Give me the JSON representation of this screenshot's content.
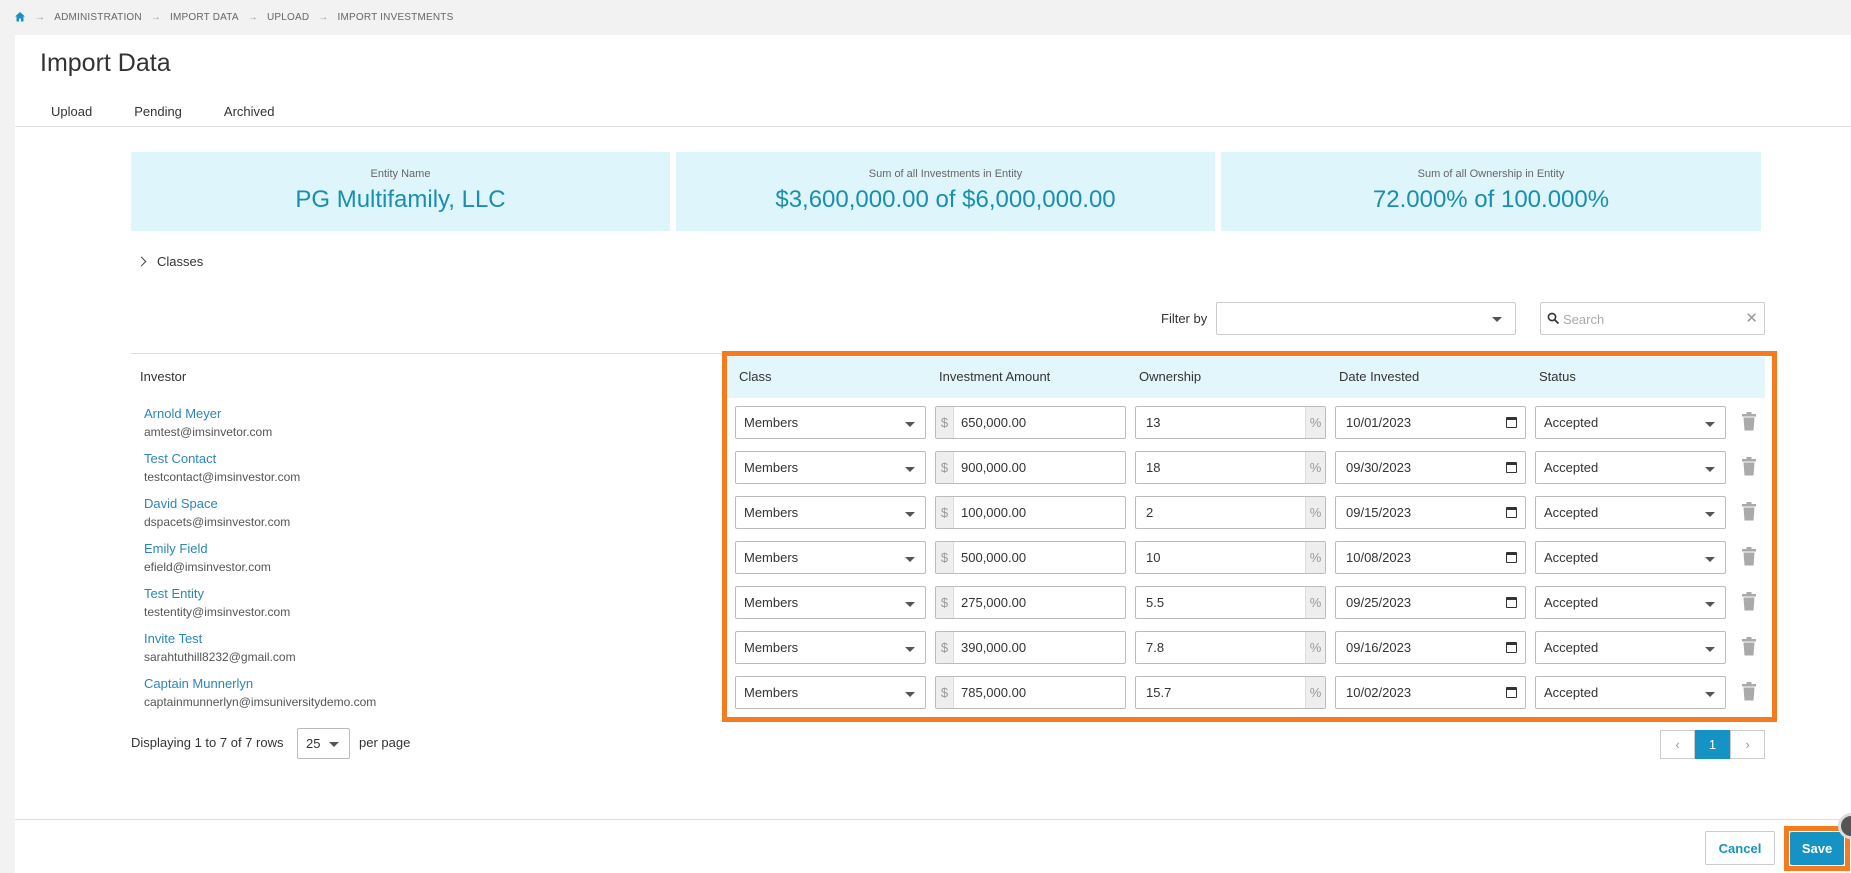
{
  "breadcrumb": [
    "ADMINISTRATION",
    "IMPORT DATA",
    "UPLOAD",
    "IMPORT INVESTMENTS"
  ],
  "page_title": "Import Data",
  "tabs": [
    "Upload",
    "Pending",
    "Archived"
  ],
  "cards": {
    "entity": {
      "label": "Entity Name",
      "value": "PG Multifamily, LLC"
    },
    "investments": {
      "label": "Sum of all Investments in Entity",
      "value": "$3,600,000.00 of $6,000,000.00"
    },
    "ownership": {
      "label": "Sum of all Ownership in Entity",
      "value": "72.000% of 100.000%"
    }
  },
  "classes_label": "Classes",
  "filter": {
    "label": "Filter by",
    "value": ""
  },
  "search": {
    "placeholder": "Search",
    "value": ""
  },
  "table": {
    "headers": {
      "investor": "Investor",
      "class": "Class",
      "amount": "Investment Amount",
      "ownership": "Ownership",
      "date": "Date Invested",
      "status": "Status"
    },
    "currency_symbol": "$",
    "percent_symbol": "%",
    "rows": [
      {
        "name": "Arnold Meyer",
        "email": "amtest@imsinvetor.com",
        "class": "Members",
        "amount": "650,000.00",
        "ownership": "13",
        "date": "10/01/2023",
        "status": "Accepted"
      },
      {
        "name": "Test Contact",
        "email": "testcontact@imsinvestor.com",
        "class": "Members",
        "amount": "900,000.00",
        "ownership": "18",
        "date": "09/30/2023",
        "status": "Accepted"
      },
      {
        "name": "David Space",
        "email": "dspacets@imsinvestor.com",
        "class": "Members",
        "amount": "100,000.00",
        "ownership": "2",
        "date": "09/15/2023",
        "status": "Accepted"
      },
      {
        "name": "Emily Field",
        "email": "efield@imsinvestor.com",
        "class": "Members",
        "amount": "500,000.00",
        "ownership": "10",
        "date": "10/08/2023",
        "status": "Accepted"
      },
      {
        "name": "Test Entity",
        "email": "testentity@imsinvestor.com",
        "class": "Members",
        "amount": "275,000.00",
        "ownership": "5.5",
        "date": "09/25/2023",
        "status": "Accepted"
      },
      {
        "name": "Invite Test",
        "email": "sarahtuthill8232@gmail.com",
        "class": "Members",
        "amount": "390,000.00",
        "ownership": "7.8",
        "date": "09/16/2023",
        "status": "Accepted"
      },
      {
        "name": "Captain Munnerlyn",
        "email": "captainmunnerlyn@imsuniversitydemo.com",
        "class": "Members",
        "amount": "785,000.00",
        "ownership": "15.7",
        "date": "10/02/2023",
        "status": "Accepted"
      }
    ]
  },
  "pagination": {
    "display_text": "Displaying 1 to 7 of 7 rows",
    "page_size": "25",
    "per_page_label": "per page",
    "prev": "‹",
    "next": "›",
    "current_page": "1"
  },
  "footer": {
    "cancel_label": "Cancel",
    "save_label": "Save"
  },
  "colors": {
    "accent": "#1593c4",
    "card_bg": "#def5fb",
    "highlight": "#f47b20"
  }
}
